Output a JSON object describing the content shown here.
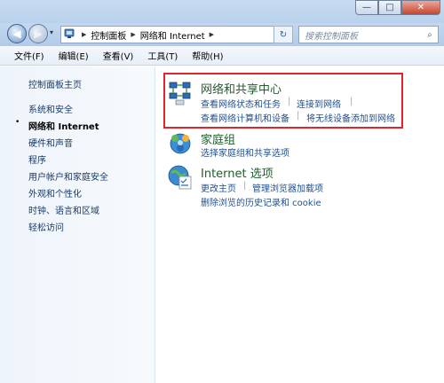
{
  "window": {
    "minimize_glyph": "—",
    "maximize_glyph": "□",
    "close_glyph": "✕"
  },
  "nav": {
    "back_glyph": "◀",
    "forward_glyph": "▶",
    "address": {
      "crumbs": [
        "控制面板",
        "网络和 Internet"
      ],
      "separator": "▶",
      "dropdown_glyph": "▾"
    },
    "refresh_glyph": "↻",
    "search": {
      "placeholder": "搜索控制面板",
      "icon_glyph": "⌕"
    }
  },
  "menu": {
    "items": [
      "文件(F)",
      "编辑(E)",
      "查看(V)",
      "工具(T)",
      "帮助(H)"
    ]
  },
  "sidebar": {
    "items": [
      {
        "label": "控制面板主页",
        "current": false
      },
      {
        "label": "系统和安全",
        "current": false
      },
      {
        "label": "网络和 Internet",
        "current": true
      },
      {
        "label": "硬件和声音",
        "current": false
      },
      {
        "label": "程序",
        "current": false
      },
      {
        "label": "用户帐户和家庭安全",
        "current": false
      },
      {
        "label": "外观和个性化",
        "current": false
      },
      {
        "label": "时钟、语言和区域",
        "current": false
      },
      {
        "label": "轻松访问",
        "current": false
      }
    ],
    "bullet": "•"
  },
  "categories": [
    {
      "title": "网络和共享中心",
      "icon": "network-sharing-icon",
      "links": [
        "查看网络状态和任务",
        "连接到网络",
        "查看网络计算机和设备",
        "将无线设备添加到网络"
      ]
    },
    {
      "title": "家庭组",
      "icon": "homegroup-icon",
      "links": [
        "选择家庭组和共享选项"
      ]
    },
    {
      "title": "Internet 选项",
      "icon": "internet-options-icon",
      "links": [
        "更改主页",
        "管理浏览器加载项",
        "删除浏览的历史记录和 cookie"
      ]
    }
  ],
  "colors": {
    "category_title": "#1f5d2b",
    "link": "#1f4f8f",
    "highlight_border": "#e0262a"
  }
}
